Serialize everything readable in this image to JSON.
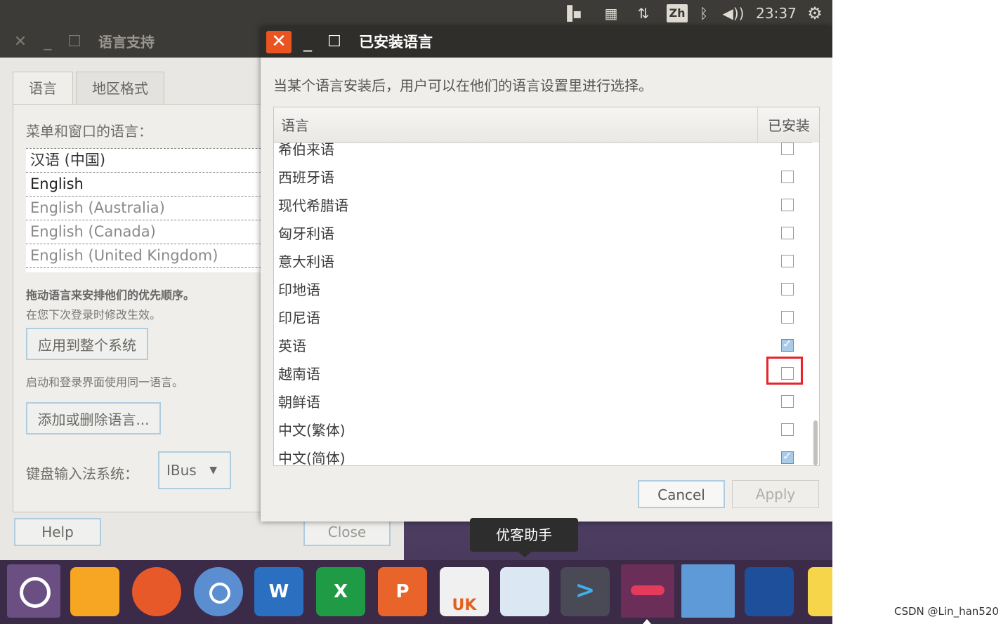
{
  "top_panel": {
    "input_method": "Zh",
    "time": "23:37",
    "icons": [
      "keyboard-indicator-icon",
      "calendar-icon",
      "network-updown-icon",
      "bluetooth-icon",
      "volume-icon",
      "settings-gear-icon"
    ]
  },
  "language_support": {
    "title": "语言支持",
    "tabs": [
      "语言",
      "地区格式"
    ],
    "menu_label": "菜单和窗口的语言：",
    "languages": [
      "汉语 (中国)",
      "English",
      "English (Australia)",
      "English (Canada)",
      "English (United Kingdom)"
    ],
    "drag_hint": "拖动语言来安排他们的优先顺序。",
    "relogin_hint": "在您下次登录时修改生效。",
    "apply_all_label": "应用到整个系统",
    "login_hint": "启动和登录界面使用同一语言。",
    "add_remove_label": "添加或删除语言...",
    "keyboard_label": "键盘输入法系统：",
    "keyboard_value": "IBus",
    "help_label": "Help",
    "close_label": "Close"
  },
  "installed_dialog": {
    "title": "已安装语言",
    "description": "当某个语言安装后，用户可以在他们的语言设置里进行选择。",
    "col_language": "语言",
    "col_installed": "已安装",
    "rows": [
      {
        "label": "希伯来语",
        "installed": false
      },
      {
        "label": "西班牙语",
        "installed": false
      },
      {
        "label": "现代希腊语",
        "installed": false
      },
      {
        "label": "匈牙利语",
        "installed": false
      },
      {
        "label": "意大利语",
        "installed": false
      },
      {
        "label": "印地语",
        "installed": false
      },
      {
        "label": "印尼语",
        "installed": false
      },
      {
        "label": "英语",
        "installed": true
      },
      {
        "label": "越南语",
        "installed": false
      },
      {
        "label": "朝鲜语",
        "installed": false
      },
      {
        "label": "中文(繁体)",
        "installed": false
      },
      {
        "label": "中文(简体)",
        "installed": true
      }
    ],
    "cancel_label": "Cancel",
    "apply_label": "Apply",
    "highlight_color": "#e8242b"
  },
  "tooltip": "优客助手",
  "launcher": {
    "ukstore_badge": "UK",
    "word_letter": "W",
    "excel_letter": "X",
    "ppt_letter": "P"
  },
  "watermark": "CSDN @Lin_han520",
  "accent_color": "#e95420"
}
